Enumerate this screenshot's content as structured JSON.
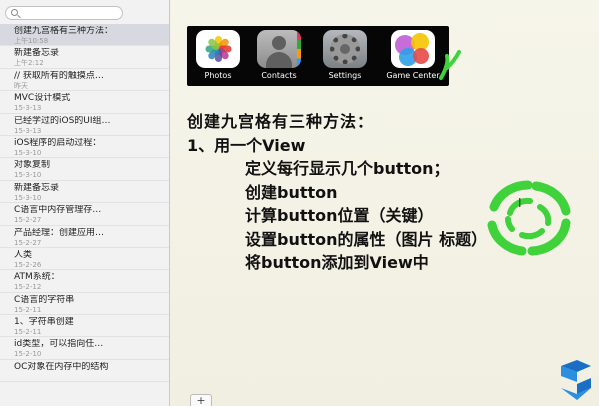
{
  "sidebar": {
    "search": {
      "placeholder": ""
    },
    "notes": [
      {
        "title": "创建九宫格有三种方法：",
        "date": "上午10:58"
      },
      {
        "title": "新建备忘录",
        "date": "上午2:12"
      },
      {
        "title": "// 获取所有的触摸点…",
        "date": "昨天"
      },
      {
        "title": "MVC设计模式",
        "date": "15-3-13"
      },
      {
        "title": "已经学过的iOS的UI组…",
        "date": "15-3-13"
      },
      {
        "title": "iOS程序的启动过程：",
        "date": "15-3-10"
      },
      {
        "title": "对象复制",
        "date": "15-3-10"
      },
      {
        "title": "新建备忘录",
        "date": "15-3-10"
      },
      {
        "title": "C语言中内存管理存…",
        "date": "15-2-27"
      },
      {
        "title": "产品经理：创建应用…",
        "date": "15-2-27"
      },
      {
        "title": "人类",
        "date": "15-2-26"
      },
      {
        "title": "ATM系统：",
        "date": "15-2-12"
      },
      {
        "title": "C语言的字符串",
        "date": "15-2-11"
      },
      {
        "title": "1、字符串创建",
        "date": "15-2-11"
      },
      {
        "title": "id类型，可以指向任…",
        "date": "15-2-10"
      },
      {
        "title": "OC对象在内存中的结构",
        "date": ""
      }
    ],
    "add_label": "+"
  },
  "dock": {
    "apps": [
      {
        "label": "Photos",
        "icon": "photos-icon"
      },
      {
        "label": "Contacts",
        "icon": "contacts-icon"
      },
      {
        "label": "Settings",
        "icon": "settings-icon"
      },
      {
        "label": "Game Center",
        "icon": "game-center-icon"
      }
    ]
  },
  "note": {
    "lines": [
      "创建九宫格有三种方法：",
      "1、用一个View",
      "定义每行显示几个button；",
      "创建button",
      "计算button位置（关键）",
      "设置button的属性（图片    标题）",
      "将button添加到View中"
    ]
  },
  "colors": {
    "accent_green": "#3fd23a",
    "dock_bg": "#060606",
    "selected_row": "#d6d9df"
  }
}
